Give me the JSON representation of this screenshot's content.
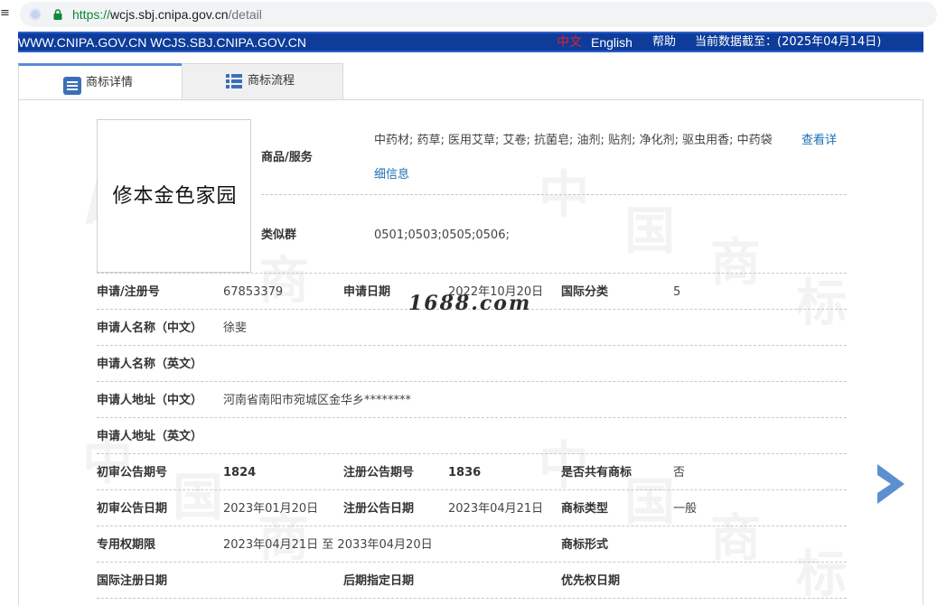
{
  "browser": {
    "menu_glyph": "≡",
    "url_protocol": "https://",
    "url_host": "wcjs.sbj.cnipa.gov.cn",
    "url_path": "/detail",
    "info_icon": "info-circle-icon",
    "lock_icon": "lock-icon"
  },
  "site_header": {
    "domains": "WWW.CNIPA.GOV.CN WCJS.SBJ.CNIPA.GOV.CN",
    "lang_zh": "中文",
    "lang_en": "English",
    "help": "帮助",
    "data_date": "当前数据截至：(2025年04月14日)",
    "colors": {
      "bar": "#0d3c9b",
      "lang_zh": "#e8202a"
    }
  },
  "tabs": [
    {
      "label": "商标详情",
      "icon": "document-list-icon",
      "active": true
    },
    {
      "label": "商标流程",
      "icon": "flow-list-icon",
      "active": false
    }
  ],
  "trademark": {
    "image_text": "修本金色家园"
  },
  "details": {
    "goods_label": "商品/服务",
    "goods_value": "中药材; 药草; 医用艾草; 艾卷; 抗菌皂; 油剂; 贴剂; 净化剂; 驱虫用香; 中药袋",
    "goods_link_1": "查看详",
    "goods_link_2": "细信息",
    "similar_group_label": "类似群",
    "similar_group_value": "0501;0503;0505;0506;",
    "reg_no_label": "申请/注册号",
    "reg_no_value": "67853379",
    "app_date_label": "申请日期",
    "app_date_value": "2022年10月20日",
    "intl_class_label": "国际分类",
    "intl_class_value": "5",
    "applicant_cn_label": "申请人名称（中文）",
    "applicant_cn_value": "徐斐",
    "applicant_en_label": "申请人名称（英文）",
    "address_cn_label": "申请人地址（中文）",
    "address_cn_value": "河南省南阳市宛城区金华乡********",
    "address_en_label": "申请人地址（英文）",
    "prelim_no_label": "初审公告期号",
    "prelim_no_value": "1824",
    "reg_pub_no_label": "注册公告期号",
    "reg_pub_no_value": "1836",
    "shared_label": "是否共有商标",
    "shared_value": "否",
    "prelim_date_label": "初审公告日期",
    "prelim_date_value": "2023年01月20日",
    "reg_pub_date_label": "注册公告日期",
    "reg_pub_date_value": "2023年04月21日",
    "tm_type_label": "商标类型",
    "tm_type_value": "一般",
    "exclusive_label": "专用权期限",
    "exclusive_value": "2023年04月21日 至 2033年04月20日",
    "tm_form_label": "商标形式",
    "intl_reg_date_label": "国际注册日期",
    "later_designation_label": "后期指定日期",
    "priority_date_label": "优先权日期"
  },
  "overlay": {
    "site_watermark": "1688.com",
    "next_arrow_icon": "chevron-right-icon",
    "arrow_color": "#5b8fd0"
  },
  "watermarks": [
    "中",
    "国",
    "商",
    "标"
  ]
}
